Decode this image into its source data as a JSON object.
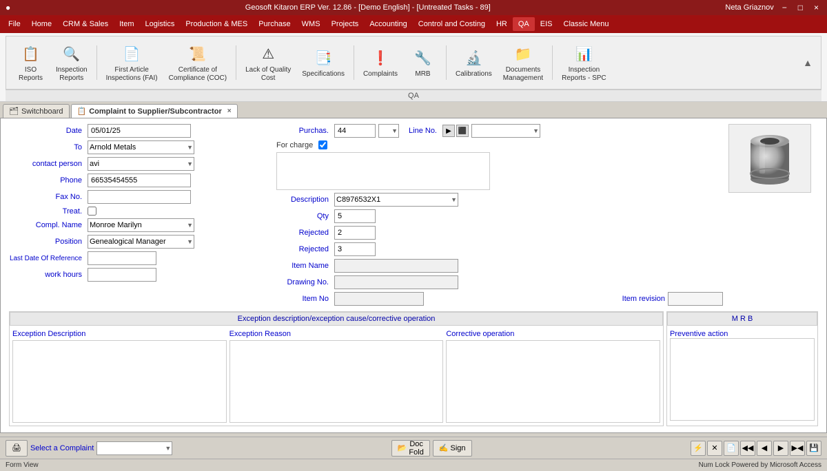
{
  "titleBar": {
    "appName": "Geosoft Kitaron ERP Ver. 12.86 - [Demo English] - [Untreated Tasks - 89]",
    "minimize": "−",
    "maximize": "□",
    "close": "×",
    "user": "Neta Griaznov",
    "icon": "●"
  },
  "menuBar": {
    "items": [
      {
        "label": "File",
        "active": false
      },
      {
        "label": "Home",
        "active": false
      },
      {
        "label": "CRM & Sales",
        "active": false
      },
      {
        "label": "Item",
        "active": false
      },
      {
        "label": "Logistics",
        "active": false
      },
      {
        "label": "Production & MES",
        "active": false
      },
      {
        "label": "Purchase",
        "active": false
      },
      {
        "label": "WMS",
        "active": false
      },
      {
        "label": "Projects",
        "active": false
      },
      {
        "label": "Accounting",
        "active": false
      },
      {
        "label": "Control and Costing",
        "active": false
      },
      {
        "label": "HR",
        "active": false
      },
      {
        "label": "QA",
        "active": true
      },
      {
        "label": "EIS",
        "active": false
      },
      {
        "label": "Classic Menu",
        "active": false
      }
    ]
  },
  "ribbon": {
    "tabLabel": "QA",
    "buttons": [
      {
        "id": "iso-reports",
        "label": "ISO\nReports",
        "icon": "📋"
      },
      {
        "id": "inspection-reports",
        "label": "Inspection\nReports",
        "icon": "🔍"
      },
      {
        "id": "first-article",
        "label": "First Article\nInspections (FAI)",
        "icon": "📄"
      },
      {
        "id": "cert-compliance",
        "label": "Certificate of\nCompliance (COC)",
        "icon": "📜"
      },
      {
        "id": "lack-quality",
        "label": "Lack of Quality\nCost",
        "icon": "⚠"
      },
      {
        "id": "specifications",
        "label": "Specifications",
        "icon": "📑"
      },
      {
        "id": "complaints",
        "label": "Complaints",
        "icon": "❗"
      },
      {
        "id": "mrb",
        "label": "MRB",
        "icon": "🔧"
      },
      {
        "id": "calibrations",
        "label": "Calibrations",
        "icon": "🔬"
      },
      {
        "id": "documents-mgmt",
        "label": "Documents\nManagement",
        "icon": "📁"
      },
      {
        "id": "inspection-reports-spc",
        "label": "Inspection\nReports - SPC",
        "icon": "📊"
      }
    ]
  },
  "tabs": [
    {
      "label": "Switchboard",
      "active": false,
      "icon": "🗂"
    },
    {
      "label": "Complaint to Supplier/Subcontractor",
      "active": true,
      "icon": "📋"
    }
  ],
  "form": {
    "fields": {
      "date_label": "Date",
      "date_value": "05/01/25",
      "to_label": "To",
      "to_value": "Arnold Metals",
      "contact_person_label": "contact person",
      "contact_person_value": "avi",
      "phone_label": "Phone",
      "phone_value": "66535454555",
      "fax_label": "Fax No.",
      "fax_value": "",
      "treat_label": "Treat.",
      "compl_name_label": "Compl. Name",
      "compl_name_value": "Monroe Marilyn",
      "position_label": "Position",
      "position_value": "Genealogical Manager",
      "last_date_label": "Last Date Of Reference",
      "last_date_value": "",
      "work_hours_label": "work hours",
      "work_hours_value": "",
      "purchas_label": "Purchas.",
      "purchas_value": "44",
      "line_no_label": "Line No.",
      "line_no_value": "",
      "for_charge_label": "For charge",
      "description_label": "Description",
      "description_value": "C8976532X1",
      "qty_label": "Qty",
      "qty_value": "5",
      "rejected_label1": "Rejected",
      "rejected_value1": "2",
      "rejected_label2": "Rejected",
      "rejected_value2": "3",
      "item_name_label": "Item Name",
      "item_name_value": "",
      "drawing_no_label": "Drawing No.",
      "drawing_no_value": "",
      "item_no_label": "Item No",
      "item_no_value": "",
      "item_revision_label": "Item revision",
      "item_revision_value": ""
    },
    "exceptionSection": {
      "header": "Exception description/exception cause/corrective operation",
      "columns": [
        {
          "label": "Exception Description",
          "id": "exception-desc"
        },
        {
          "label": "Exception Reason",
          "id": "exception-reason"
        },
        {
          "label": "Corrective operation",
          "id": "corrective-op"
        },
        {
          "label": "Preventive action",
          "id": "preventive-action"
        }
      ]
    },
    "mrbSection": {
      "header": "M R B"
    }
  },
  "bottomBar": {
    "print_label": "Print",
    "select_complaint_label": "Select a Complaint",
    "doc_fold_label": "Doc\nFold",
    "sign_label": "Sign",
    "nav_buttons": [
      "⚡",
      "✕",
      "📄",
      "◀◀",
      "◀",
      "▶",
      "▶▶",
      "💾"
    ]
  },
  "statusBar": {
    "left": "Form View",
    "right": "Num Lock    Powered by Microsoft Access"
  },
  "colors": {
    "menuRed": "#a01010",
    "activeTab": "#cc3333",
    "labelBlue": "#0000cc",
    "background": "#d4d0c8"
  }
}
